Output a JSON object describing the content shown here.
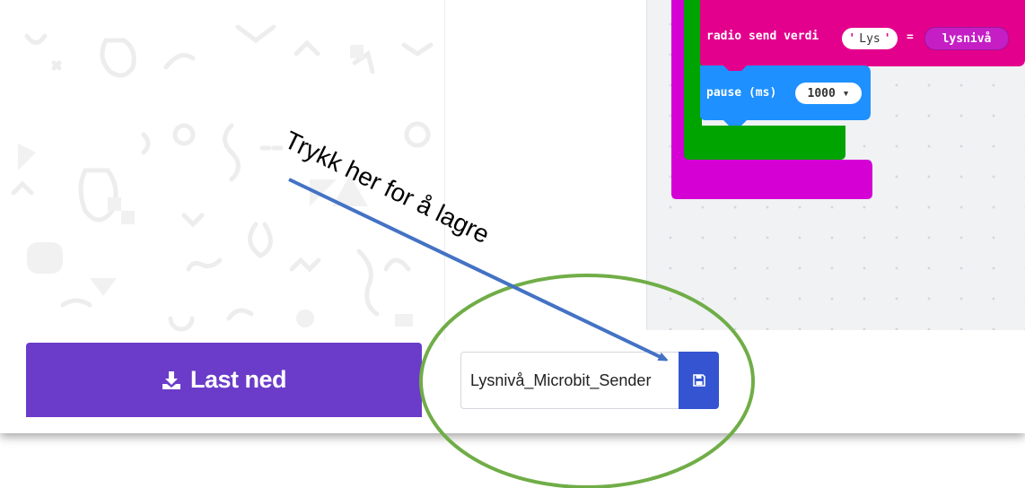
{
  "blocks": {
    "radio_send": {
      "label": "radio send verdi",
      "string_value": "Lys",
      "equals": "=",
      "variable": "lysnivå"
    },
    "pause": {
      "label": "pause (ms)",
      "value": "1000 ▾"
    }
  },
  "toolbar": {
    "download_label": "Last ned",
    "download_icon": "download-icon",
    "filename_value": "Lysnivå_Microbit_Sender",
    "save_icon": "save-icon"
  },
  "annotation": {
    "text": "Trykk her for å lagre"
  },
  "colors": {
    "radio_block": "#e3008c",
    "pause_block": "#1e90ff",
    "loop_green": "#00a400",
    "forever_magenta": "#d400d4",
    "download_button": "#6a3cc9",
    "save_button": "#3454d1",
    "arrow": "#4472c4",
    "highlight_ellipse": "#70ad47"
  }
}
